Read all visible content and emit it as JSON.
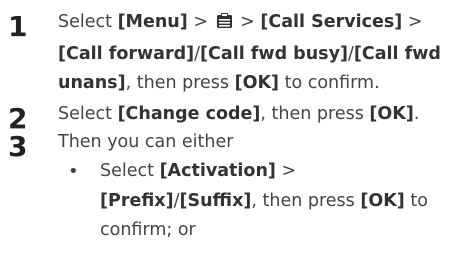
{
  "steps": [
    {
      "number": "1",
      "line1_a": "Select ",
      "menu": "[Menu]",
      "gt1": " > ",
      "gt2": " > ",
      "call_services": "[Call Services]",
      "gt3": " >",
      "call_forward": "[Call forward]",
      "slash1": "/",
      "call_fwd_busy": "[Call fwd busy]",
      "slash2": "/",
      "call_fwd_unans": "[Call fwd unans]",
      "then_press": ", then press ",
      "ok": "[OK]",
      "to_confirm": " to confirm."
    },
    {
      "number": "2",
      "select": "Select ",
      "change_code": "[Change code]",
      "then_press": ", then press ",
      "ok": "[OK]",
      "end": "."
    },
    {
      "number": "3",
      "text": "Then you can either"
    }
  ],
  "bullet": {
    "dot": "•",
    "select": "Select ",
    "activation": "[Activation]",
    "gt": " >",
    "prefix": "[Prefix]",
    "slash": "/",
    "suffix": "[Suffix]",
    "then_press": ", then press ",
    "ok": "[OK]",
    "to": " to",
    "confirm_or": "confirm; or"
  },
  "icons": {
    "settings_icon": "clipboard-icon"
  }
}
